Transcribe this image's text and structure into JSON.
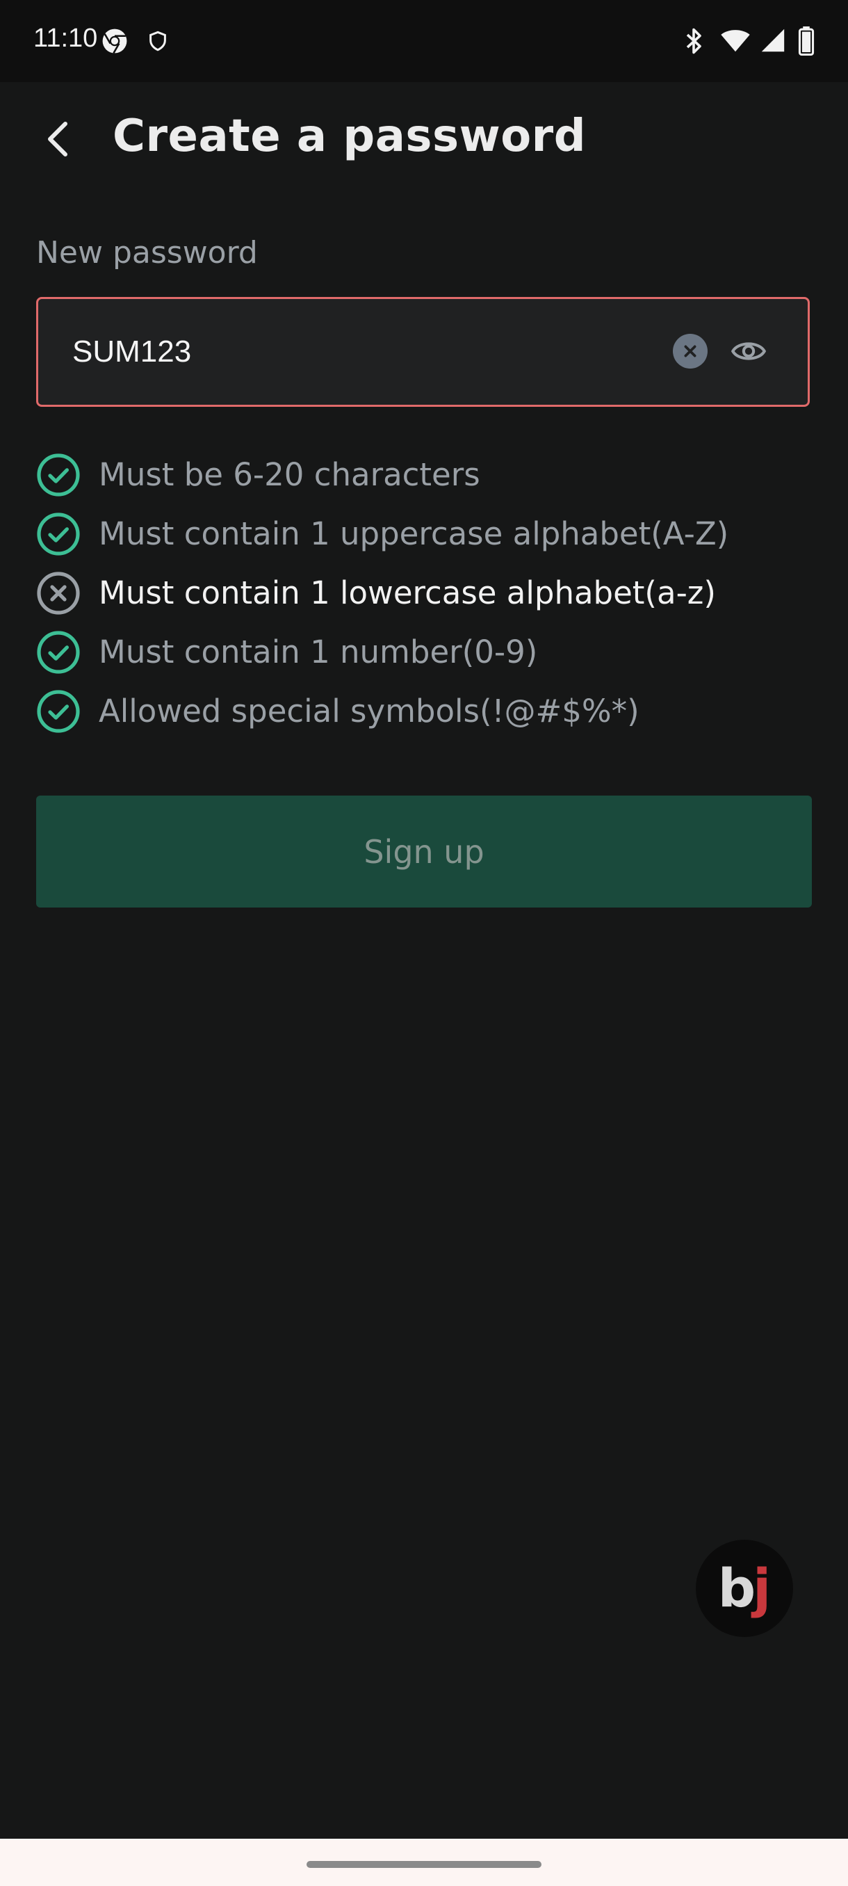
{
  "status_bar": {
    "time": "11:10",
    "icons": [
      "chrome-icon",
      "shield-icon",
      "bluetooth-icon",
      "wifi-icon",
      "signal-icon",
      "battery-icon"
    ]
  },
  "header": {
    "title": "Create a password",
    "back_icon": "chevron-left-icon"
  },
  "form": {
    "label": "New password",
    "value": "SUM123",
    "error_border_color": "#e06a6a",
    "clear_icon": "clear-icon",
    "visibility_icon": "eye-icon"
  },
  "rules": [
    {
      "text": "Must be 6-20 characters",
      "status": "ok"
    },
    {
      "text": "Must contain 1 uppercase alphabet(A-Z)",
      "status": "ok"
    },
    {
      "text": "Must contain 1 lowercase alphabet(a-z)",
      "status": "bad"
    },
    {
      "text": "Must contain 1 number(0-9)",
      "status": "ok"
    },
    {
      "text": "Allowed special symbols(!@#$%*)",
      "status": "ok"
    }
  ],
  "colors": {
    "ok": "#3dbf95",
    "bad": "#9aa0a6",
    "button_bg": "#1a4a3c"
  },
  "signup": {
    "label": "Sign up"
  },
  "fab": {
    "logo_b": "b",
    "logo_j": "j"
  }
}
